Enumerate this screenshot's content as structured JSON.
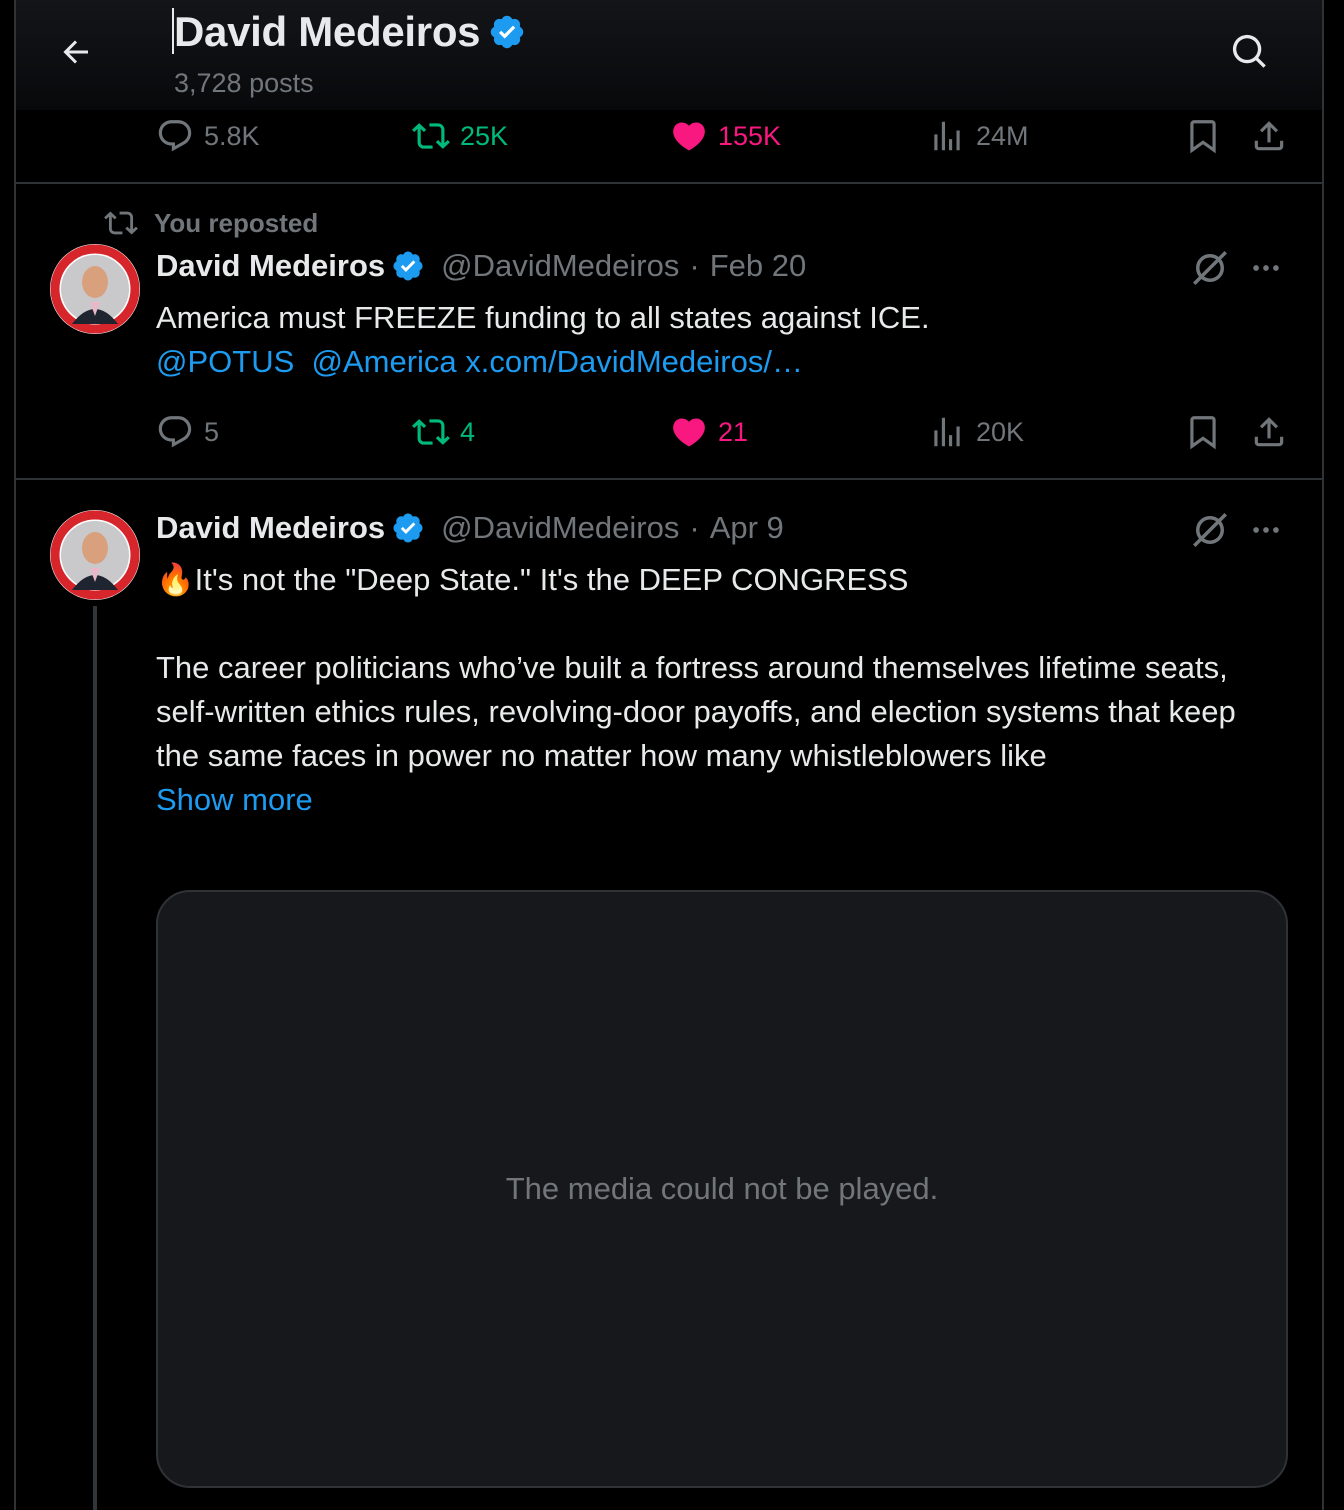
{
  "header": {
    "title": "David Medeiros",
    "subtitle": "3,728 posts",
    "back_icon": "arrow-left-icon",
    "search_icon": "search-icon"
  },
  "top_actions": {
    "replies": "5.8K",
    "reposts": "25K",
    "likes": "155K",
    "views": "24M"
  },
  "tweets": [
    {
      "repost_label": "You reposted",
      "name": "David Medeiros",
      "handle": "@DavidMedeiros",
      "separator": "·",
      "date": "Feb 20",
      "text_line1": "America must FREEZE funding to all states against ICE.",
      "mention1": "@POTUS",
      "mention2": "@America",
      "url": "x.com/DavidMedeiros/…",
      "replies": "5",
      "reposts": "4",
      "likes": "21",
      "views": "20K"
    },
    {
      "name": "David Medeiros",
      "handle": "@DavidMedeiros",
      "separator": "·",
      "date": "Apr 9",
      "emoji": "🔥",
      "headline": "It's not the \"Deep State.\" It's the DEEP CONGRESS",
      "body": "The career politicians who’ve built a fortress around themselves lifetime seats, self-written ethics rules, revolving-door payoffs, and election systems that keep the same faces in power no matter how many whistleblowers like",
      "show_more": "Show more",
      "media_message": "The media could not be played."
    }
  ],
  "colors": {
    "background": "#000000",
    "text": "#e7e9ea",
    "muted": "#71767b",
    "link": "#1d9bf0",
    "repost": "#00ba7c",
    "like": "#f91880",
    "border": "#2f3336",
    "verified": "#1d9bf0"
  }
}
